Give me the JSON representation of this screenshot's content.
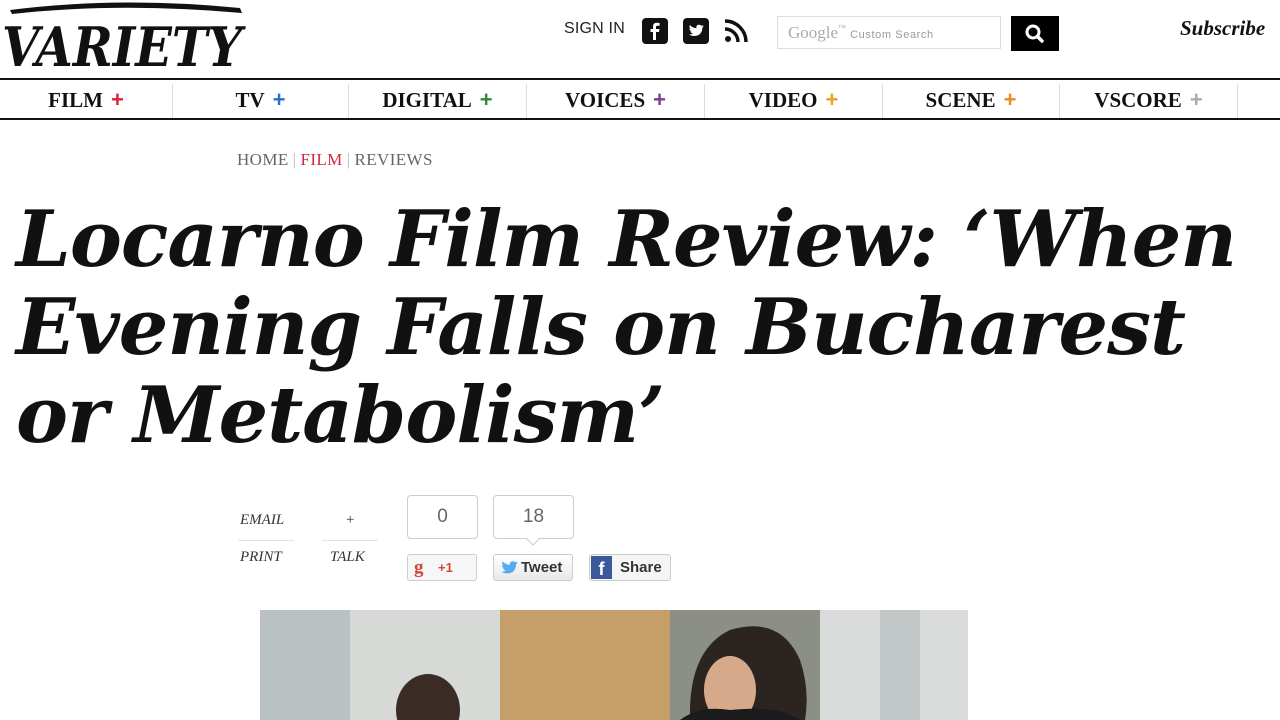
{
  "header": {
    "logo_text": "VARIETY",
    "sign_in": "SIGN IN",
    "social_icons": [
      "facebook-icon",
      "twitter-icon",
      "rss-icon"
    ],
    "search": {
      "placeholder_brand": "Google",
      "placeholder_label": "Custom Search"
    },
    "subscribe": "Subscribe"
  },
  "nav": {
    "items": [
      {
        "label": "FILM",
        "plus_color": "#d6243c"
      },
      {
        "label": "TV",
        "plus_color": "#2a6fc9"
      },
      {
        "label": "DIGITAL",
        "plus_color": "#2e8b3a"
      },
      {
        "label": "VOICES",
        "plus_color": "#7a3c98"
      },
      {
        "label": "VIDEO",
        "plus_color": "#f0a01a"
      },
      {
        "label": "SCENE",
        "plus_color": "#f08a1a"
      },
      {
        "label": "VSCORE",
        "plus_color": "#aaaaaa"
      }
    ]
  },
  "breadcrumb": {
    "home": "HOME",
    "film": "FILM",
    "reviews": "REVIEWS",
    "separator": "|"
  },
  "article": {
    "headline": "Locarno Film Review: ‘When Evening Falls on Bucharest or Metabolism’"
  },
  "tools": {
    "email": "EMAIL",
    "plus": "+",
    "print": "PRINT",
    "talk": "TALK"
  },
  "share": {
    "gplus_count": "0",
    "gplus_label": "+1",
    "tweet_count": "18",
    "tweet_label": "Tweet",
    "fb_label": "Share"
  },
  "colors": {
    "brand_accent": "#cc2a41",
    "search_button": "#000000",
    "facebook": "#3b5998",
    "twitter": "#55acee"
  }
}
